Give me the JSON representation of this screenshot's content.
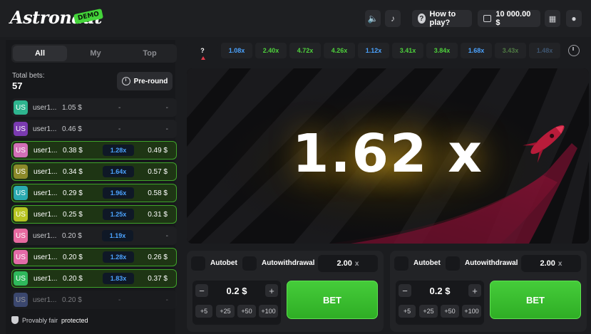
{
  "header": {
    "logo_text": "Astronaut",
    "demo_badge": "DEMO",
    "sound_icon": "speaker-icon",
    "music_icon": "music-note-icon",
    "how_to_play_label": "How to play?",
    "balance": "10 000.00 $",
    "menu_icon": "grid-icon",
    "chat_icon": "chat-icon"
  },
  "left": {
    "tabs": [
      {
        "label": "All",
        "active": true
      },
      {
        "label": "My",
        "active": false
      },
      {
        "label": "Top",
        "active": false
      }
    ],
    "total_label": "Total bets:",
    "total_value": "57",
    "preround_label": "Pre-round",
    "bets": [
      {
        "avatar": "US",
        "color": "#2eb58f",
        "user": "user1...",
        "bet": "1.05 $",
        "mult": "",
        "win": "",
        "status": "pending"
      },
      {
        "avatar": "US",
        "color": "#7a3ab0",
        "user": "user1...",
        "bet": "0.46 $",
        "mult": "",
        "win": "",
        "status": "pending"
      },
      {
        "avatar": "US",
        "color": "#d26fb6",
        "user": "user1...",
        "bet": "0.38 $",
        "mult": "1.28x",
        "win": "0.49 $",
        "status": "won"
      },
      {
        "avatar": "US",
        "color": "#8c8a2a",
        "user": "user1...",
        "bet": "0.34 $",
        "mult": "1.64x",
        "win": "0.57 $",
        "status": "won"
      },
      {
        "avatar": "US",
        "color": "#2aaab0",
        "user": "user1...",
        "bet": "0.29 $",
        "mult": "1.96x",
        "win": "0.58 $",
        "status": "won"
      },
      {
        "avatar": "US",
        "color": "#b7c422",
        "user": "user1...",
        "bet": "0.25 $",
        "mult": "1.25x",
        "win": "0.31 $",
        "status": "won"
      },
      {
        "avatar": "US",
        "color": "#e76aa0",
        "user": "user1...",
        "bet": "0.20 $",
        "mult": "1.19x",
        "win": "",
        "status": "pending"
      },
      {
        "avatar": "US",
        "color": "#e36ba8",
        "user": "user1...",
        "bet": "0.20 $",
        "mult": "1.28x",
        "win": "0.26 $",
        "status": "won"
      },
      {
        "avatar": "US",
        "color": "#2fb85c",
        "user": "user1...",
        "bet": "0.20 $",
        "mult": "1.83x",
        "win": "0.37 $",
        "status": "won"
      },
      {
        "avatar": "US",
        "color": "#5a6fb3",
        "user": "user1...",
        "bet": "0.20 $",
        "mult": "",
        "win": "",
        "status": "faded"
      }
    ],
    "dash": "-",
    "fair_prefix": "Provably fair",
    "fair_suffix": "protected"
  },
  "history": [
    {
      "label": "?",
      "color": "#ffffff"
    },
    {
      "label": "1.08x",
      "color": "#4ba3ff"
    },
    {
      "label": "2.40x",
      "color": "#4ed13c"
    },
    {
      "label": "4.72x",
      "color": "#4ed13c"
    },
    {
      "label": "4.26x",
      "color": "#4ed13c"
    },
    {
      "label": "1.12x",
      "color": "#4ba3ff"
    },
    {
      "label": "3.41x",
      "color": "#4ed13c"
    },
    {
      "label": "3.84x",
      "color": "#4ed13c"
    },
    {
      "label": "1.68x",
      "color": "#4ba3ff"
    },
    {
      "label": "3.43x",
      "color": "#4f7a43"
    },
    {
      "label": "1.48x",
      "color": "#3e5570"
    }
  ],
  "game": {
    "multiplier": "1.62x",
    "multiplier_display": "1.62 x"
  },
  "panels": [
    {
      "autobet_label": "Autobet",
      "autowithdrawal_label": "Autowithdrawal",
      "auto_value": "2.00",
      "auto_suffix": "x",
      "stake": "0.2 $",
      "quick": [
        "+5",
        "+25",
        "+50",
        "+100"
      ],
      "bet_label": "BET"
    },
    {
      "autobet_label": "Autobet",
      "autowithdrawal_label": "Autowithdrawal",
      "auto_value": "2.00",
      "auto_suffix": "x",
      "stake": "0.2 $",
      "quick": [
        "+5",
        "+25",
        "+50",
        "+100"
      ],
      "bet_label": "BET"
    }
  ],
  "colors": {
    "accent_green": "#3fbf30",
    "accent_blue": "#4ba3ff",
    "trail_red": "#8a1430"
  }
}
